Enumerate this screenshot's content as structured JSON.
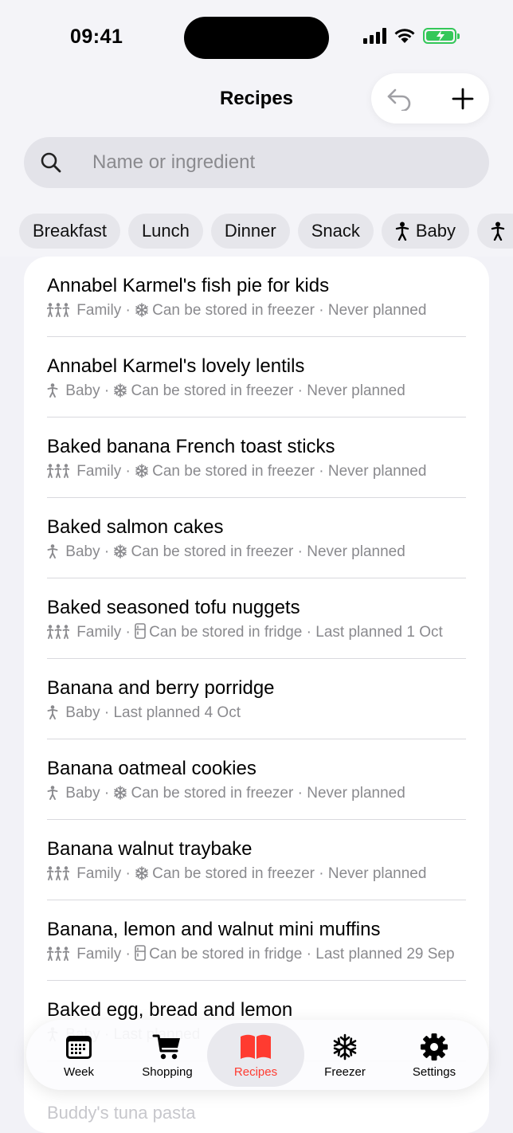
{
  "status_bar": {
    "time": "09:41"
  },
  "nav": {
    "title": "Recipes",
    "undo_icon": "undo-icon",
    "add_icon": "plus-icon"
  },
  "search": {
    "placeholder": "Name or ingredient",
    "value": ""
  },
  "filters": [
    "Breakfast",
    "Lunch",
    "Dinner",
    "Snack",
    "Baby"
  ],
  "recipes": [
    {
      "title": "Annabel Karmel's fish pie for kids",
      "audience": "Family",
      "storage": "freezer",
      "storage_text": "Can be stored in freezer",
      "planned": "Never planned"
    },
    {
      "title": "Annabel Karmel's lovely lentils",
      "audience": "Baby",
      "storage": "freezer",
      "storage_text": "Can be stored in freezer",
      "planned": "Never planned"
    },
    {
      "title": "Baked banana French toast sticks",
      "audience": "Family",
      "storage": "freezer",
      "storage_text": "Can be stored in freezer",
      "planned": "Never planned"
    },
    {
      "title": "Baked salmon cakes",
      "audience": "Baby",
      "storage": "freezer",
      "storage_text": "Can be stored in freezer",
      "planned": "Never planned"
    },
    {
      "title": "Baked seasoned tofu nuggets",
      "audience": "Family",
      "storage": "fridge",
      "storage_text": "Can be stored in fridge",
      "planned": "Last planned 1 Oct"
    },
    {
      "title": "Banana and berry porridge",
      "audience": "Baby",
      "storage": "",
      "storage_text": "",
      "planned": "Last planned 4 Oct"
    },
    {
      "title": "Banana oatmeal cookies",
      "audience": "Baby",
      "storage": "freezer",
      "storage_text": "Can be stored in freezer",
      "planned": "Never planned"
    },
    {
      "title": "Banana walnut traybake",
      "audience": "Family",
      "storage": "freezer",
      "storage_text": "Can be stored in freezer",
      "planned": "Never planned"
    },
    {
      "title": "Banana, lemon and walnut mini muffins",
      "audience": "Family",
      "storage": "fridge",
      "storage_text": "Can be stored in fridge",
      "planned": "Last planned 29 Sep"
    },
    {
      "title": "Baked egg, bread and lemon",
      "audience": "Baby",
      "storage": "",
      "storage_text": "",
      "planned": "Last planned"
    }
  ],
  "peek_text": "Buddy's tuna pasta",
  "tabs": [
    {
      "label": "Week",
      "icon": "calendar-icon"
    },
    {
      "label": "Shopping",
      "icon": "cart-icon"
    },
    {
      "label": "Recipes",
      "icon": "book-icon",
      "active": true
    },
    {
      "label": "Freezer",
      "icon": "snowflake-icon"
    },
    {
      "label": "Settings",
      "icon": "gear-icon"
    }
  ],
  "colors": {
    "accent": "#ff3b30",
    "battery": "#34c759",
    "secondary_text": "#8a8a8e"
  }
}
